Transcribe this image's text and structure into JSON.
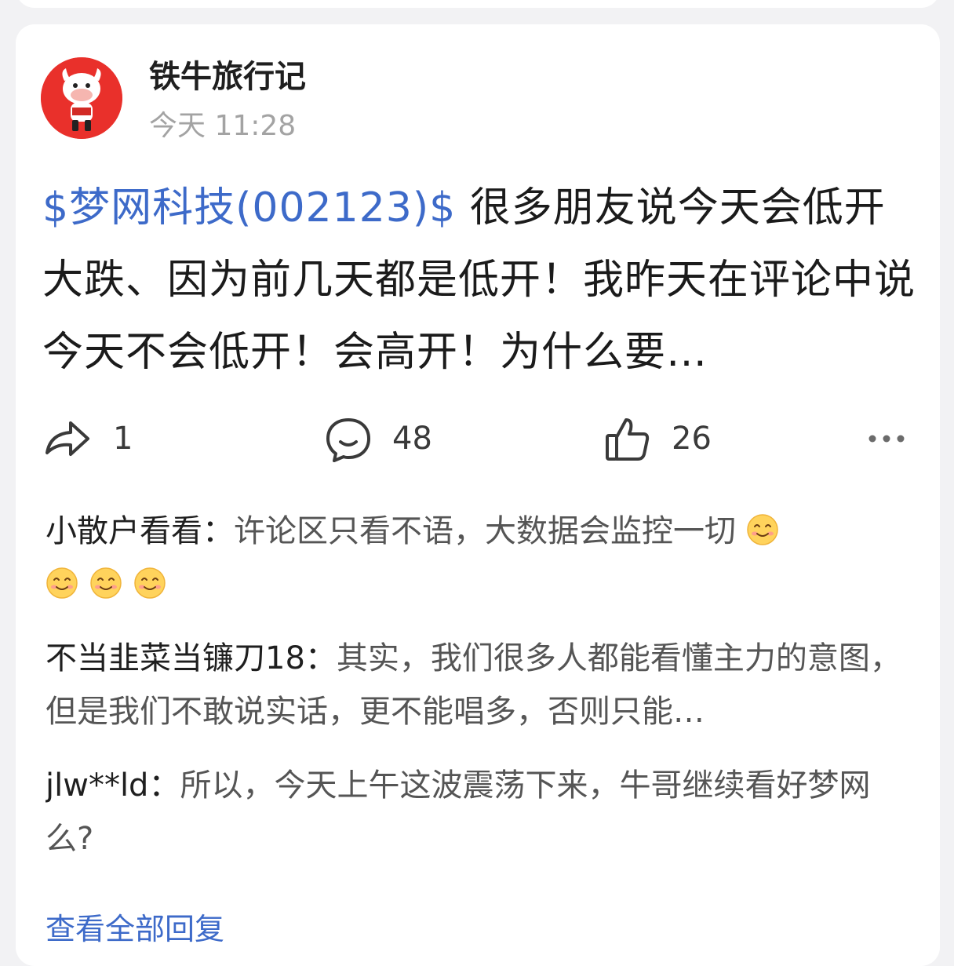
{
  "post": {
    "author": "铁牛旅行记",
    "time": "今天 11:28",
    "stock_tag": "$梦网科技(002123)$",
    "text": " 很多朋友说今天会低开大跌、因为前几天都是低开！我昨天在评论中说今天不会低开！会高开！为什么要…"
  },
  "actions": {
    "share_count": "1",
    "comment_count": "48",
    "like_count": "26"
  },
  "comments": [
    {
      "author": "小散户看看：",
      "text": "许论区只看不语，大数据会监控一切",
      "emoji_count": 4
    },
    {
      "author": "不当韭菜当镰刀18：",
      "text": "其实，我们很多人都能看懂主力的意图，但是我们不敢说实话，更不能唱多，否则只能…"
    },
    {
      "author": "jlw**ld：",
      "text": "所以，今天上午这波震荡下来，牛哥继续看好梦网么?"
    }
  ],
  "view_all": "查看全部回复",
  "colors": {
    "link": "#3d6ac9",
    "avatar_bg": "#e9302b",
    "background": "#f2f2f4"
  }
}
